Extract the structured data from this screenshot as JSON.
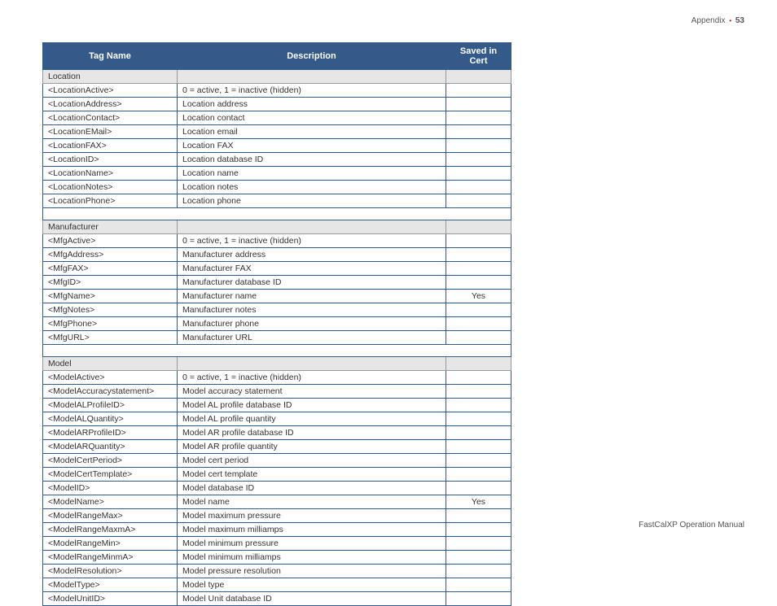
{
  "header": {
    "section": "Appendix",
    "page": "53"
  },
  "columns": {
    "tag": "Tag Name",
    "desc": "Description",
    "saved": "Saved in Cert"
  },
  "sections": [
    {
      "title": "Location",
      "rows": [
        {
          "tag": "<LocationActive>",
          "desc": "0 = active, 1 = inactive (hidden)",
          "saved": ""
        },
        {
          "tag": "<LocationAddress>",
          "desc": "Location address",
          "saved": ""
        },
        {
          "tag": "<LocationContact>",
          "desc": "Location contact",
          "saved": ""
        },
        {
          "tag": "<LocationEMail>",
          "desc": "Location email",
          "saved": ""
        },
        {
          "tag": "<LocationFAX>",
          "desc": "Location FAX",
          "saved": ""
        },
        {
          "tag": "<LocationID>",
          "desc": "Location database ID",
          "saved": ""
        },
        {
          "tag": "<LocationName>",
          "desc": "Location name",
          "saved": ""
        },
        {
          "tag": "<LocationNotes>",
          "desc": "Location notes",
          "saved": ""
        },
        {
          "tag": "<LocationPhone>",
          "desc": "Location phone",
          "saved": ""
        }
      ]
    },
    {
      "title": "Manufacturer",
      "rows": [
        {
          "tag": "<MfgActive>",
          "desc": "0 = active, 1 = inactive (hidden)",
          "saved": ""
        },
        {
          "tag": "<MfgAddress>",
          "desc": "Manufacturer address",
          "saved": ""
        },
        {
          "tag": "<MfgFAX>",
          "desc": "Manufacturer FAX",
          "saved": ""
        },
        {
          "tag": "<MfgID>",
          "desc": "Manufacturer database ID",
          "saved": ""
        },
        {
          "tag": "<MfgName>",
          "desc": "Manufacturer name",
          "saved": "Yes"
        },
        {
          "tag": "<MfgNotes>",
          "desc": "Manufacturer notes",
          "saved": ""
        },
        {
          "tag": "<MfgPhone>",
          "desc": "Manufacturer phone",
          "saved": ""
        },
        {
          "tag": "<MfgURL>",
          "desc": "Manufacturer URL",
          "saved": ""
        }
      ]
    },
    {
      "title": "Model",
      "rows": [
        {
          "tag": "<ModelActive>",
          "desc": "0 = active, 1 = inactive (hidden)",
          "saved": ""
        },
        {
          "tag": "<ModelAccuracystatement>",
          "desc": "Model accuracy statement",
          "saved": ""
        },
        {
          "tag": "<ModelALProfileID>",
          "desc": "Model AL profile database ID",
          "saved": ""
        },
        {
          "tag": "<ModelALQuantity>",
          "desc": "Model AL profile quantity",
          "saved": ""
        },
        {
          "tag": "<ModelARProfileID>",
          "desc": "Model AR profile database ID",
          "saved": ""
        },
        {
          "tag": "<ModelARQuantity>",
          "desc": "Model AR profile quantity",
          "saved": ""
        },
        {
          "tag": "<ModelCertPeriod>",
          "desc": "Model cert period",
          "saved": ""
        },
        {
          "tag": "<ModelCertTemplate>",
          "desc": "Model cert template",
          "saved": ""
        },
        {
          "tag": "<ModelID>",
          "desc": "Model database ID",
          "saved": ""
        },
        {
          "tag": "<ModelName>",
          "desc": "Model name",
          "saved": "Yes"
        },
        {
          "tag": "<ModelRangeMax>",
          "desc": "Model maximum pressure",
          "saved": ""
        },
        {
          "tag": "<ModelRangeMaxmA>",
          "desc": "Model maximum milliamps",
          "saved": ""
        },
        {
          "tag": "<ModelRangeMin>",
          "desc": "Model minimum pressure",
          "saved": ""
        },
        {
          "tag": "<ModelRangeMinmA>",
          "desc": "Model minimum milliamps",
          "saved": ""
        },
        {
          "tag": "<ModelResolution>",
          "desc": "Model pressure resolution",
          "saved": ""
        },
        {
          "tag": "<ModelType>",
          "desc": "Model type",
          "saved": ""
        },
        {
          "tag": "<ModelUnitID>",
          "desc": "Model Unit database ID",
          "saved": ""
        }
      ]
    }
  ],
  "footer": {
    "text": "FastCalXP Operation Manual"
  }
}
